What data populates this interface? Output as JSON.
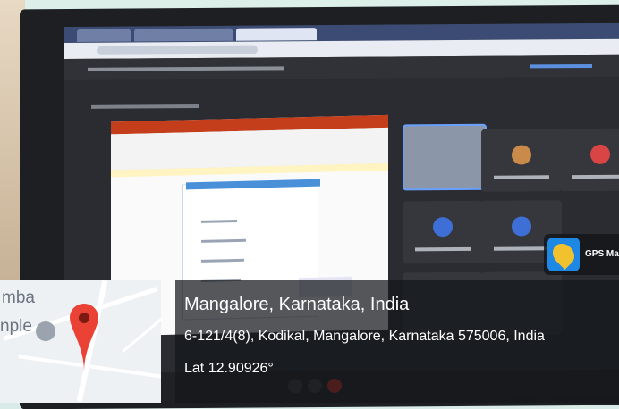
{
  "overlay": {
    "title": "Mangalore, Karnataka, India",
    "address": "6-121/4(8), Kodikal, Mangalore, Karnataka 575006, India",
    "latitude": "Lat 12.90926°"
  },
  "map": {
    "label_top": "mba",
    "label_bottom": "nple"
  },
  "badge": {
    "app_label": "GPS Ma"
  },
  "colors": {
    "pin_red": "#ea4335",
    "overlay_bg": "#14161a",
    "screen_bg": "#2a2c31"
  },
  "icons": {
    "pin": "map-pin-icon",
    "badge": "gps-camera-app-icon"
  }
}
